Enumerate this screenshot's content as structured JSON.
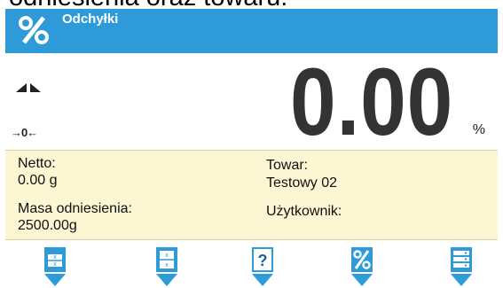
{
  "page_caption": "odniesienia oraz towaru:",
  "header": {
    "title": "Odchyłki",
    "mode_icon": "percent-icon",
    "color": "#2e9bd8"
  },
  "readout": {
    "value": "0.00",
    "unit": "%",
    "zero_indicator": "→0←",
    "stability_icon": "stability-marker-icon"
  },
  "info": {
    "netto_label": "Netto:",
    "netto_value": "0.00 g",
    "reference_mass_label": "Masa odniesienia:",
    "reference_mass_value": "2500.00g",
    "product_label": "Towar:",
    "product_value": "Testowy 02",
    "user_label": "Użytkownik:",
    "user_value": "",
    "background": "#fcf6d2"
  },
  "softkeys": [
    {
      "icon": "reference-weight-icon"
    },
    {
      "icon": "tolerance-icon"
    },
    {
      "icon": "help-icon"
    },
    {
      "icon": "percent-icon"
    },
    {
      "icon": "database-icon"
    }
  ]
}
